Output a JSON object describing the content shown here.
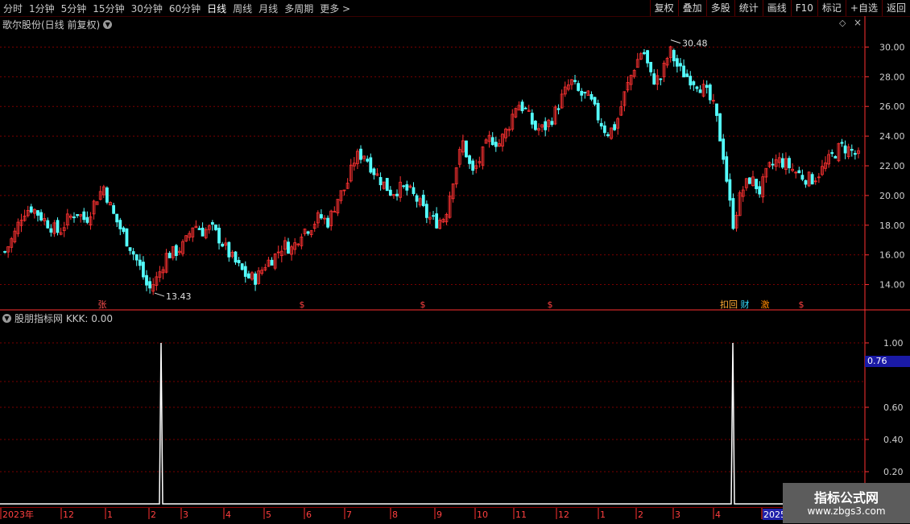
{
  "toolbar": {
    "periods": [
      "分时",
      "1分钟",
      "5分钟",
      "15分钟",
      "30分钟",
      "60分钟",
      "日线",
      "周线",
      "月线",
      "多周期",
      "更多 >"
    ],
    "active_period": "日线",
    "right_buttons": [
      "复权",
      "叠加",
      "多股",
      "统计",
      "画线",
      "F10",
      "标记",
      "+自选",
      "返回"
    ]
  },
  "main_pane": {
    "title": "歌尔股份(日线 前复权)",
    "menu_icon": "chevron-down-icon",
    "diamond_icon": "diamond-icon",
    "price_axis": [
      "30.00",
      "28.00",
      "26.00",
      "24.00",
      "22.00",
      "20.00",
      "18.00",
      "16.00",
      "14.00"
    ],
    "high_label": "30.48",
    "low_label": "13.43",
    "signal_markers": [
      "张",
      "$",
      "$",
      "$",
      "扣回",
      "财",
      "激",
      "$"
    ]
  },
  "indicator_pane": {
    "title": "股朋指标网 KKK: 0.00",
    "axis": [
      "1.00",
      "0.60",
      "0.40",
      "0.20"
    ],
    "current_value": "0.76"
  },
  "date_axis": [
    "2023年",
    "12",
    "1",
    "2",
    "3",
    "4",
    "5",
    "6",
    "7",
    "8",
    "9",
    "10",
    "11",
    "12",
    "1",
    "2",
    "3",
    "4",
    "2025"
  ],
  "watermark": {
    "line1": "指标公式网",
    "line2": "www.zbgs3.com"
  },
  "colors": {
    "up": "#ff3232",
    "down": "#54ffff",
    "grid": "#7a0000",
    "axis": "#ff3030",
    "indicator": "#ffffff"
  },
  "chart_data": {
    "type": "candlestick",
    "ylim": [
      13.0,
      31.0
    ],
    "high": 30.48,
    "low": 13.43,
    "close_path": [
      16.2,
      17.3,
      18.9,
      19.2,
      18.6,
      18.0,
      17.5,
      18.4,
      18.9,
      18.3,
      19.6,
      20.6,
      18.8,
      17.6,
      16.5,
      15.2,
      13.6,
      14.5,
      16.0,
      16.2,
      16.7,
      18.1,
      17.6,
      17.8,
      17.0,
      16.0,
      15.2,
      14.5,
      14.4,
      15.4,
      15.9,
      16.7,
      16.4,
      17.6,
      17.9,
      18.6,
      18.2,
      19.8,
      20.6,
      22.6,
      22.8,
      21.7,
      20.9,
      20.2,
      20.5,
      20.3,
      19.6,
      18.6,
      18.2,
      18.6,
      21.5,
      23.6,
      21.4,
      22.6,
      23.9,
      23.5,
      24.6,
      26.3,
      25.7,
      24.5,
      24.5,
      25.3,
      26.6,
      27.7,
      26.8,
      26.6,
      25.3,
      24.2,
      24.7,
      26.9,
      28.6,
      29.9,
      27.8,
      27.9,
      29.8,
      28.5,
      28.0,
      27.6,
      27.0,
      25.8,
      22.6,
      18.0,
      20.3,
      21.2,
      20.3,
      21.8,
      22.4,
      22.1,
      21.6,
      21.2,
      21.1,
      21.8,
      22.6,
      23.3,
      23.1,
      22.6
    ],
    "indicator": {
      "name": "KKK",
      "spike_positions": [
        200,
        910
      ],
      "peak_values": [
        1.0,
        1.0
      ],
      "ylim": [
        0,
        1.1
      ]
    }
  }
}
